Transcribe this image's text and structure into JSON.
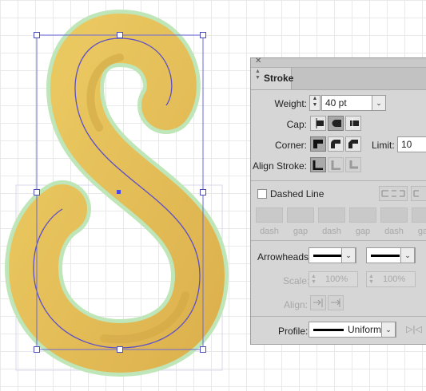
{
  "panel": {
    "tab_title": "Stroke",
    "weight": {
      "label": "Weight:",
      "value": "40 pt"
    },
    "cap": {
      "label": "Cap:",
      "options": [
        "butt-cap-icon",
        "round-cap-icon",
        "projecting-cap-icon"
      ],
      "selected": 1
    },
    "corner": {
      "label": "Corner:",
      "options": [
        "miter-join-icon",
        "round-join-icon",
        "bevel-join-icon"
      ],
      "selected": 0,
      "limit_label": "Limit:",
      "limit_value": "10"
    },
    "align_stroke": {
      "label": "Align Stroke:",
      "options": [
        "align-center-icon",
        "align-inside-icon",
        "align-outside-icon"
      ],
      "selected": 0
    },
    "dashed_line": {
      "label": "Dashed Line",
      "checked": false
    },
    "dash_fields": [
      "dash",
      "gap",
      "dash",
      "gap",
      "dash",
      "gap"
    ],
    "arrowheads": {
      "label": "Arrowheads:"
    },
    "scale": {
      "label": "Scale:",
      "start": "100%",
      "end": "100%"
    },
    "align": {
      "label": "Align:"
    },
    "profile": {
      "label": "Profile:",
      "value": "Uniform"
    }
  },
  "colors": {
    "shape_fill": "#e7c35a",
    "path_stroke": "#5b4fc9",
    "selection": "#6a6adb",
    "panel_bg": "#d6d6d6"
  }
}
